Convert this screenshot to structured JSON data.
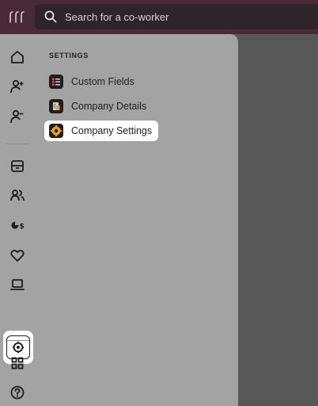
{
  "search": {
    "placeholder": "Search for a co-worker"
  },
  "rail": {
    "items": [
      {
        "icon": "home-icon"
      },
      {
        "icon": "user-plus-icon"
      },
      {
        "icon": "user-minus-icon"
      },
      {
        "icon": "inbox-icon"
      },
      {
        "icon": "users-icon"
      },
      {
        "icon": "payroll-icon"
      },
      {
        "icon": "heart-icon"
      },
      {
        "icon": "laptop-icon"
      },
      {
        "icon": "settings-icon",
        "active": true
      },
      {
        "icon": "apps-grid-icon"
      },
      {
        "icon": "help-icon"
      }
    ]
  },
  "settings": {
    "section_title": "SETTINGS",
    "items": [
      {
        "label": "Custom Fields",
        "icon": "custom-fields-icon",
        "active": false
      },
      {
        "label": "Company Details",
        "icon": "company-details-icon",
        "active": false
      },
      {
        "label": "Company Settings",
        "icon": "company-settings-icon",
        "active": true
      }
    ]
  },
  "colors": {
    "topbar": "#4a2a36",
    "search_bg": "#2d2529",
    "panel_bg": "#a3a3a3",
    "overlay_bg": "#585858",
    "active_bg": "#ffffff",
    "accent_orange": "#f0a020"
  }
}
